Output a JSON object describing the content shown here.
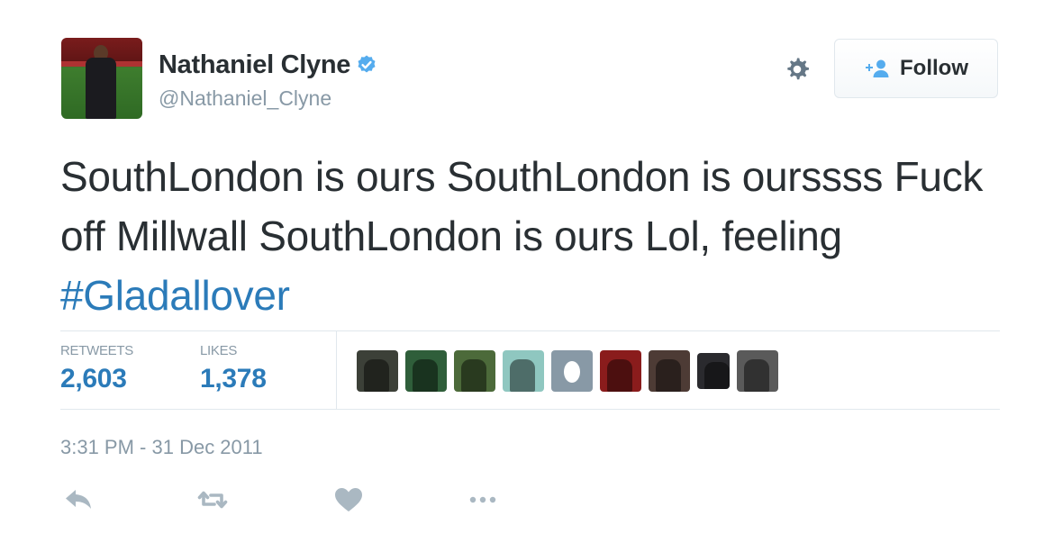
{
  "user": {
    "name": "Nathaniel Clyne",
    "handle": "@Nathaniel_Clyne",
    "verified": true
  },
  "header": {
    "follow_label": "Follow",
    "gear_icon": "gear-icon",
    "follow_icon": "add-user-icon"
  },
  "tweet": {
    "text": "SouthLondon is ours SouthLondon is ourssss Fuck off Millwall SouthLondon is ours Lol, feeling ",
    "hashtag": "#Gladallover"
  },
  "stats": {
    "retweets_label": "RETWEETS",
    "retweets_value": "2,603",
    "likes_label": "LIKES",
    "likes_value": "1,378"
  },
  "likers": [
    {
      "icon": "avatar",
      "color": "#3c4038"
    },
    {
      "icon": "avatar",
      "color": "#2f5e3a"
    },
    {
      "icon": "avatar",
      "color": "#4c6a3a"
    },
    {
      "icon": "avatar",
      "color": "#8fc7c0"
    },
    {
      "icon": "egg-avatar",
      "color": "#8899a6"
    },
    {
      "icon": "avatar",
      "color": "#8a1c1c"
    },
    {
      "icon": "avatar",
      "color": "#4d3b35"
    },
    {
      "icon": "avatar",
      "color": "#2a2a2e"
    },
    {
      "icon": "avatar",
      "color": "#5a5a5a"
    }
  ],
  "timestamp": "3:31 PM - 31 Dec 2011",
  "actions": [
    "reply-icon",
    "retweet-icon",
    "like-icon",
    "more-icon"
  ],
  "colors": {
    "link": "#2b7bb9",
    "muted": "#8899a6",
    "text": "#292f33",
    "verified": "#55acee",
    "border": "#e1e8ed"
  }
}
